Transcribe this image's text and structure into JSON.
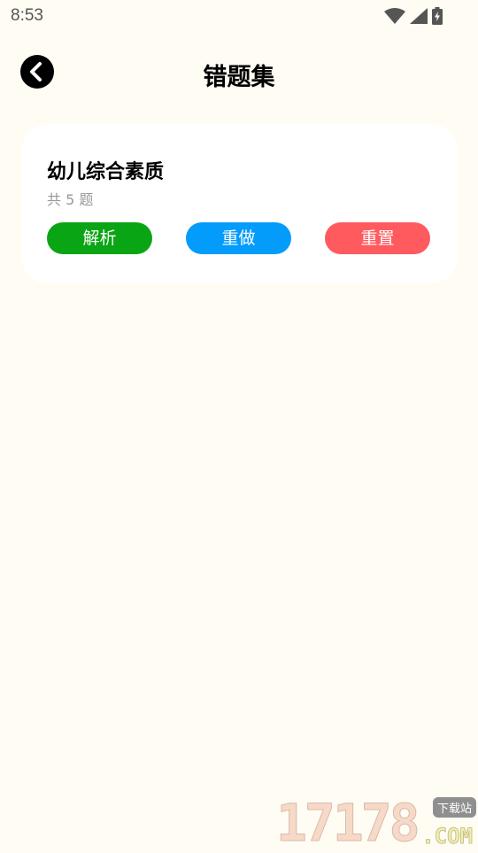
{
  "status_bar": {
    "time": "8:53",
    "icons": [
      "wifi-icon",
      "cell-signal-icon",
      "battery-charging-icon"
    ]
  },
  "header": {
    "back_icon": "chevron-left-icon",
    "title": "错题集"
  },
  "card": {
    "title": "幼儿综合素质",
    "count_text": "共 5 题",
    "buttons": {
      "analysis": {
        "label": "解析",
        "color": "#0AA514"
      },
      "redo": {
        "label": "重做",
        "color": "#049CFA"
      },
      "reset": {
        "label": "重置",
        "color": "#FF5A5E"
      }
    }
  },
  "watermark": {
    "digits": "17178",
    "badge": "下载站",
    "domain": ".COM"
  },
  "colors": {
    "background": "#FFFCF3",
    "card": "#FFFFFF"
  }
}
